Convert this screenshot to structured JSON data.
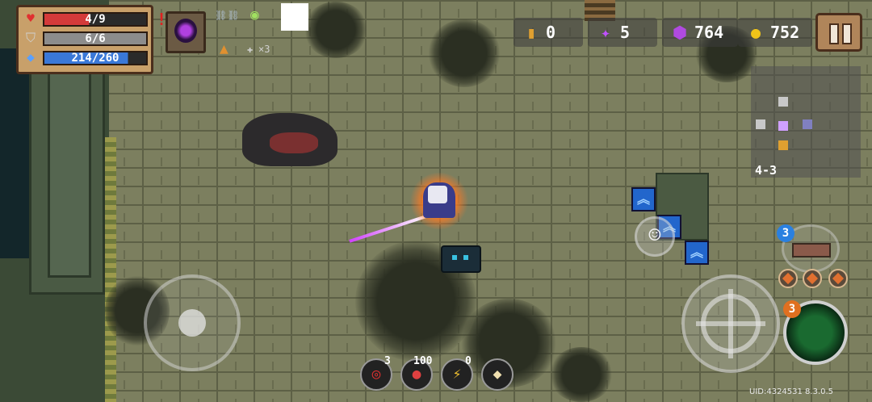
{
  "player": {
    "hp": "4/9",
    "armor": "6/6",
    "energy": "214/260",
    "hp_fill": 0.44,
    "armor_fill": 1.0,
    "energy_fill": 0.82
  },
  "alert": "!",
  "buff_stack_text": "×3",
  "resources": {
    "ammo": "0",
    "crystals": "5",
    "gems": "764",
    "gold": "752"
  },
  "minimap": {
    "level": "4-3"
  },
  "weapon": {
    "ammo_badge": "3"
  },
  "skill": {
    "charges_badge": "3"
  },
  "items": [
    {
      "name": "target-item",
      "count": "3",
      "icon": "◎"
    },
    {
      "name": "potion-item",
      "count": "100",
      "icon": "●"
    },
    {
      "name": "shield-item",
      "count": "0",
      "icon": "⚡"
    },
    {
      "name": "statue-item",
      "count": "",
      "icon": "◆"
    }
  ],
  "uid": "UID:4324531 8.3.0.5",
  "colors": {
    "hp": "#d43a3a",
    "armor": "#8c8c8c",
    "energy": "#3a78d8",
    "gold": "#f0c419",
    "gem": "#b04ae0",
    "floor": "#7c7f5f"
  },
  "icons": [
    "heart-icon",
    "shield-icon",
    "diamond-icon",
    "bullet-icon",
    "crystal-icon",
    "gem-icon",
    "coin-icon",
    "pause-icon",
    "crosshair-icon",
    "smiley-icon",
    "chevron-up-icon"
  ]
}
